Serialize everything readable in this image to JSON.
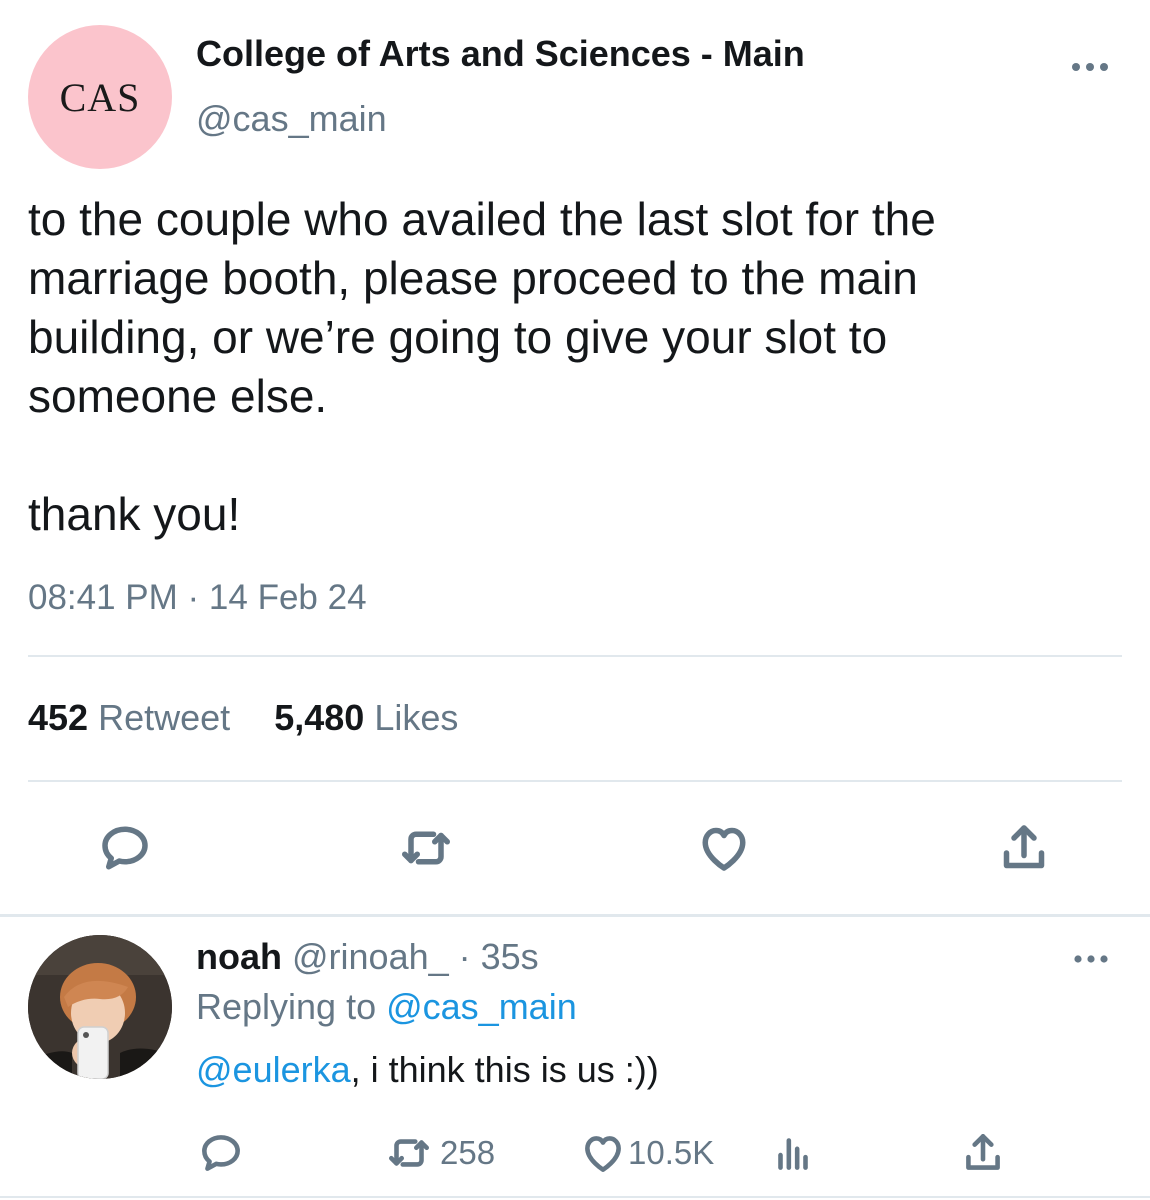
{
  "tweet": {
    "avatar_text": "CAS",
    "avatar_color": "#fbc4cc",
    "display_name": "College of Arts and Sciences - Main",
    "handle": "@cas_main",
    "body": "to the couple who availed the last slot for the\nmarriage booth, please proceed to the main\nbuilding, or we’re going to give your slot to\nsomeone else.\n\nthank you!",
    "timestamp": "08:41 PM · 14 Feb 24",
    "retweet_count": "452",
    "retweet_label": "Retweet",
    "like_count": "5,480",
    "like_label": "Likes",
    "actions": [
      "reply-icon",
      "retweet-icon",
      "like-icon",
      "share-icon"
    ]
  },
  "reply": {
    "name": "noah",
    "handle_time": " @rinoah_ · 35s",
    "replying_prefix": "Replying to ",
    "replying_handle": "@cas_main",
    "mention": "@eulerka",
    "text": ", i think this is us :))",
    "retweet_count": "258",
    "like_count": "10.5K",
    "actions": [
      "reply-icon",
      "retweet-icon",
      "like-icon",
      "analytics-icon",
      "share-icon"
    ]
  },
  "colors": {
    "text_primary": "#14171a",
    "text_secondary": "#657786",
    "link": "#1b95e0",
    "divider": "#e1e8ed"
  }
}
